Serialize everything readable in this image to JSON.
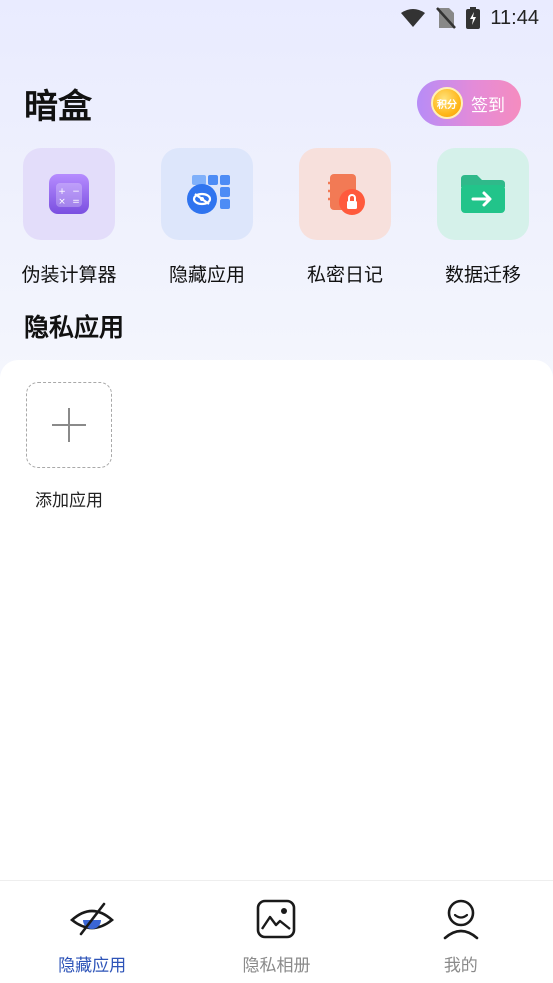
{
  "status_bar": {
    "time": "11:44"
  },
  "header": {
    "title": "暗盒",
    "checkin_label": "签到",
    "coin_text": "积分"
  },
  "features": [
    {
      "label": "伪装计算器",
      "icon": "calculator-icon"
    },
    {
      "label": "隐藏应用",
      "icon": "hidden-apps-icon"
    },
    {
      "label": "私密日记",
      "icon": "locked-diary-icon"
    },
    {
      "label": "数据迁移",
      "icon": "folder-transfer-icon"
    }
  ],
  "section": {
    "title": "隐私应用"
  },
  "add_app": {
    "label": "添加应用"
  },
  "bottom_nav": {
    "items": [
      {
        "label": "隐藏应用",
        "icon": "hidden-eye-icon",
        "active": true
      },
      {
        "label": "隐私相册",
        "icon": "photo-album-icon",
        "active": false
      },
      {
        "label": "我的",
        "icon": "profile-icon",
        "active": false
      }
    ]
  },
  "colors": {
    "accent": "#2e54b8",
    "checkin_start": "#b78cf7",
    "checkin_end": "#f58cbf"
  }
}
